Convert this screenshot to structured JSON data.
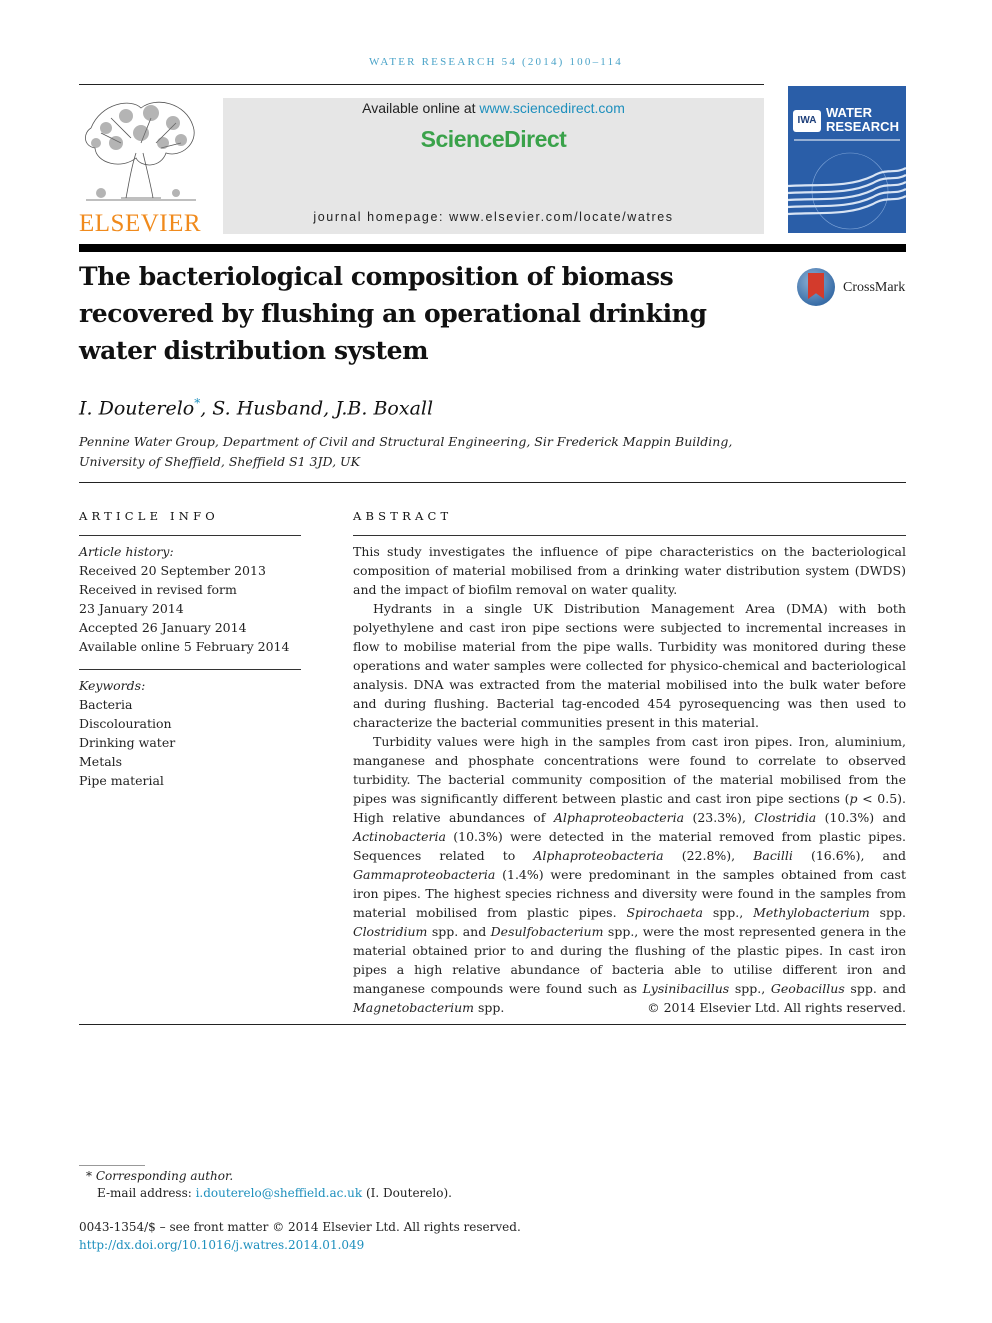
{
  "header": {
    "journal_ref": "WATER RESEARCH 54 (2014) 100–114",
    "publisher_logo_text": "ELSEVIER",
    "available_online_prefix": "Available online at ",
    "available_online_link": "www.sciencedirect.com",
    "brand": "ScienceDirect",
    "homepage": "journal homepage: www.elsevier.com/locate/watres",
    "cover": {
      "badge": "IWA",
      "title_line1": "WATER",
      "title_line2": "RESEARCH"
    },
    "crossmark_label": "CrossMark",
    "colors": {
      "journal_ref": "#4aa3c8",
      "elsevier": "#f08a1c",
      "sciencedirect": "#3aa24a",
      "link": "#1d8fbd",
      "cover_bg": "#2a5ea8"
    }
  },
  "article": {
    "title": "The bacteriological composition of biomass recovered by flushing an operational drinking water distribution system",
    "authors": [
      {
        "name": "I. Douterelo",
        "corresponding": "*"
      },
      {
        "name": ", S. Husband, J.B. Boxall"
      }
    ],
    "affiliation": "Pennine Water Group, Department of Civil and Structural Engineering, Sir Frederick Mappin Building, University of Sheffield, Sheffield S1 3JD, UK"
  },
  "article_info": {
    "heading": "ARTICLE INFO",
    "history_label": "Article history:",
    "history": [
      "Received 20 September 2013",
      "Received in revised form",
      "23 January 2014",
      "Accepted 26 January 2014",
      "Available online 5 February 2014"
    ],
    "keywords_label": "Keywords:",
    "keywords": [
      "Bacteria",
      "Discolouration",
      "Drinking water",
      "Metals",
      "Pipe material"
    ]
  },
  "abstract": {
    "heading": "ABSTRACT",
    "p1": "This study investigates the influence of pipe characteristics on the bacteriological composition of material mobilised from a drinking water distribution system (DWDS) and the impact of biofilm removal on water quality.",
    "p2": "Hydrants in a single UK Distribution Management Area (DMA) with both polyethylene and cast iron pipe sections were subjected to incremental increases in flow to mobilise material from the pipe walls. Turbidity was monitored during these operations and water samples were collected for physico-chemical and bacteriological analysis. DNA was extracted from the material mobilised into the bulk water before and during flushing. Bacterial tag-encoded 454 pyrosequencing was then used to characterize the bacterial communities present in this material.",
    "p3": [
      "Turbidity values were high in the samples from cast iron pipes. Iron, aluminium, manganese and phosphate concentrations were found to correlate to observed turbidity. The bacterial community composition of the material mobilised from the pipes was significantly different between plastic and cast iron pipe sections (",
      "p",
      " < 0.5). High relative abundances of ",
      "Alphaproteobacteria",
      " (23.3%), ",
      "Clostridia",
      " (10.3%) and ",
      "Actinobacteria",
      " (10.3%) were detected in the material removed from plastic pipes. Sequences related to ",
      "Alphaproteobacteria",
      " (22.8%), ",
      "Bacilli",
      " (16.6%), and ",
      "Gammaproteobacteria",
      " (1.4%) were predominant in the samples obtained from cast iron pipes. The highest species richness and diversity were found in the samples from material mobilised from plastic pipes. ",
      "Spirochaeta",
      " spp., ",
      "Methylobacterium",
      " spp. ",
      "Clostridium",
      " spp. and ",
      "Desulfobacterium",
      " spp., were the most represented genera in the material obtained prior to and during the flushing of the plastic pipes. In cast iron pipes a high relative abundance of bacteria able to utilise different iron and manganese compounds were found such as ",
      "Lysinibacillus",
      " spp., ",
      "Geobacillus",
      " spp. and ",
      "Magnetobacterium",
      " spp."
    ],
    "copyright": "© 2014 Elsevier Ltd. All rights reserved."
  },
  "footnotes": {
    "star": "*",
    "corresponding_label": "Corresponding author.",
    "email_prefix": "E-mail address: ",
    "email": "i.douterelo@sheffield.ac.uk",
    "email_suffix": " (I. Douterelo).",
    "front_matter": "0043-1354/$ – see front matter © 2014 Elsevier Ltd. All rights reserved.",
    "doi": "http://dx.doi.org/10.1016/j.watres.2014.01.049"
  }
}
